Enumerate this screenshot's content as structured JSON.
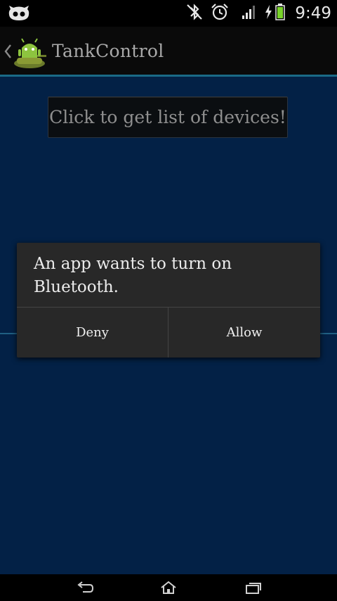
{
  "status_bar": {
    "time": "9:49",
    "icons": [
      "cyanogenmod-icon",
      "bluetooth-off-icon",
      "alarm-icon",
      "signal-icon",
      "charging-icon",
      "battery-icon"
    ],
    "battery_color": "#79d22a"
  },
  "action_bar": {
    "title": "TankControl"
  },
  "main": {
    "button_label": "Click to get list of devices!"
  },
  "dialog": {
    "message": "An app wants to turn on Bluetooth.",
    "deny_label": "Deny",
    "allow_label": "Allow"
  },
  "nav_bar": {
    "icons": [
      "back-icon",
      "home-icon",
      "recent-apps-icon"
    ]
  },
  "colors": {
    "background": "#032146",
    "accent": "#1a6a86",
    "dialog": "#282828"
  }
}
